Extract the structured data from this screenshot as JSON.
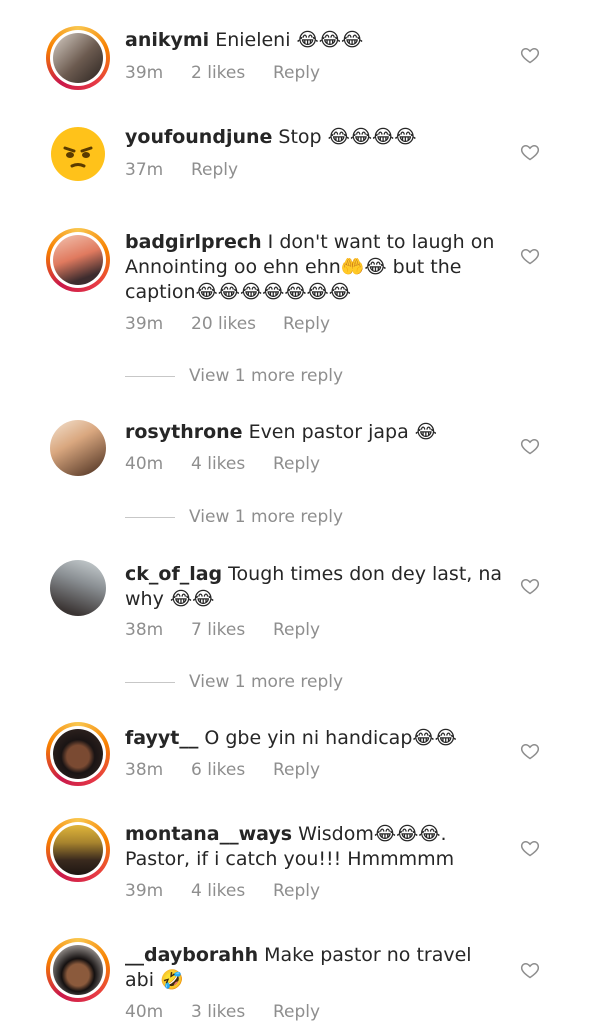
{
  "comments": [
    {
      "username": "anikymi",
      "text": "Enieleni 😂😂😂",
      "time": "39m",
      "likes": "2 likes",
      "reply": "Reply"
    },
    {
      "username": "youfoundjune",
      "text": "Stop 😂😂😂😂",
      "time": "37m",
      "likes": "",
      "reply": "Reply"
    },
    {
      "username": "badgirlprech",
      "text": "I don't want to laugh on Annointing oo ehn ehn🤲😂 but the caption😂😂😂😂😂😂😂",
      "time": "39m",
      "likes": "20 likes",
      "reply": "Reply",
      "more_replies": "View 1 more reply"
    },
    {
      "username": "rosythrone",
      "text": "Even pastor japa 😂",
      "time": "40m",
      "likes": "4 likes",
      "reply": "Reply",
      "more_replies": "View 1 more reply"
    },
    {
      "username": "ck_of_lag",
      "text": "Tough times don dey last, na why 😂😂",
      "time": "38m",
      "likes": "7 likes",
      "reply": "Reply",
      "more_replies": "View 1 more reply"
    },
    {
      "username": "fayyt__",
      "text": "O gbe yin ni handicap😂😂",
      "time": "38m",
      "likes": "6 likes",
      "reply": "Reply"
    },
    {
      "username": "montana__ways",
      "text": "Wisdom😂😂😂. Pastor, if i catch you!!! Hmmmmm",
      "time": "39m",
      "likes": "4 likes",
      "reply": "Reply"
    },
    {
      "username": "__dayborahh",
      "text": "Make pastor no travel abi 🤣",
      "time": "40m",
      "likes": "3 likes",
      "reply": "Reply"
    }
  ],
  "icons": {
    "like": "heart-outline-icon"
  },
  "colors": {
    "text": "#262626",
    "meta": "#8e8e8e"
  }
}
